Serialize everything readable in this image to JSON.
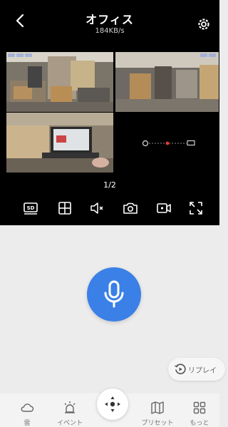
{
  "header": {
    "title": "オフィス",
    "speed": "184KB/s"
  },
  "pager": {
    "label": "1/2"
  },
  "feeds": [
    {
      "name": "camera-1"
    },
    {
      "name": "camera-2"
    },
    {
      "name": "camera-3"
    }
  ],
  "toolbar": {
    "items": [
      "sd-quality",
      "layout-grid",
      "mute",
      "snapshot",
      "record",
      "fullscreen"
    ]
  },
  "replay": {
    "label": "リプレイ"
  },
  "nav": {
    "items": [
      {
        "label": "雲",
        "icon": "cloud-icon"
      },
      {
        "label": "イベント",
        "icon": "alarm-icon"
      },
      {
        "label": "",
        "icon": "ptz-control-icon"
      },
      {
        "label": "プリセット",
        "icon": "map-icon"
      },
      {
        "label": "もっと",
        "icon": "grid-icon"
      }
    ]
  },
  "colors": {
    "accent": "#3a80e6",
    "top_background": "#000000",
    "panel_background": "#ececec",
    "link_dot": "#e53935"
  }
}
